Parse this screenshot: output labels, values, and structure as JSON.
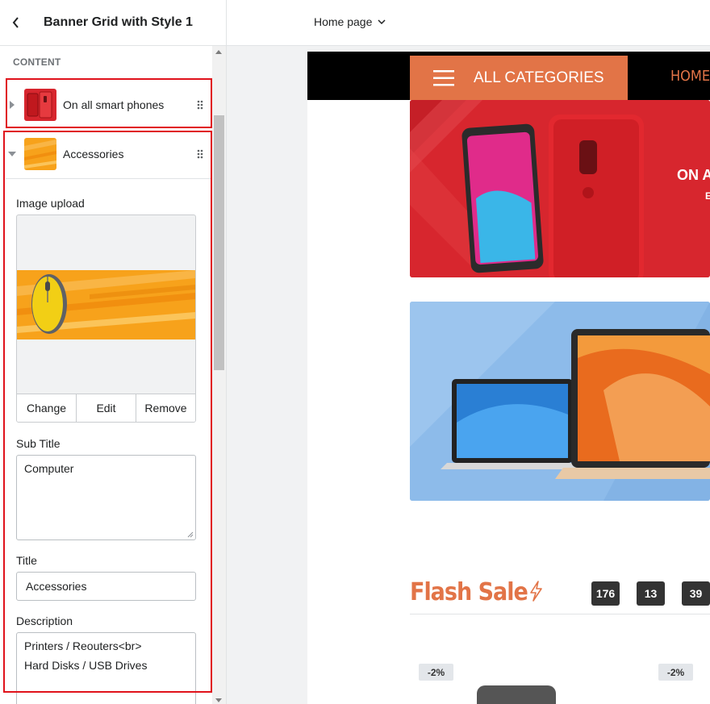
{
  "panel": {
    "title": "Banner Grid with Style 1",
    "section_label": "CONTENT",
    "blocks": [
      {
        "label": "On all smart phones"
      },
      {
        "label": "Accessories"
      }
    ],
    "form": {
      "image_upload_label": "Image upload",
      "change_label": "Change",
      "edit_label": "Edit",
      "remove_label": "Remove",
      "sub_title_label": "Sub Title",
      "sub_title_value": "Computer",
      "title_label": "Title",
      "title_value": "Accessories",
      "description_label": "Description",
      "description_line1": "Printers / Reouters<br>",
      "description_line2": "Hard Disks / USB Drives"
    }
  },
  "topbar": {
    "page_selector": "Home page"
  },
  "preview": {
    "all_categories": "ALL CATEGORIES",
    "home_link": "HOME",
    "banner1_title": "ON A",
    "banner1_sub": "E",
    "flash_sale": "Flash Sale",
    "countdown": [
      "176",
      "13",
      "39"
    ],
    "discounts": [
      "-2%",
      "-2%"
    ]
  },
  "colors": {
    "accent": "#e27447",
    "highlight_box": "#e0121b",
    "banner_red": "#d7262e",
    "banner_blue": "#88b7e8"
  }
}
